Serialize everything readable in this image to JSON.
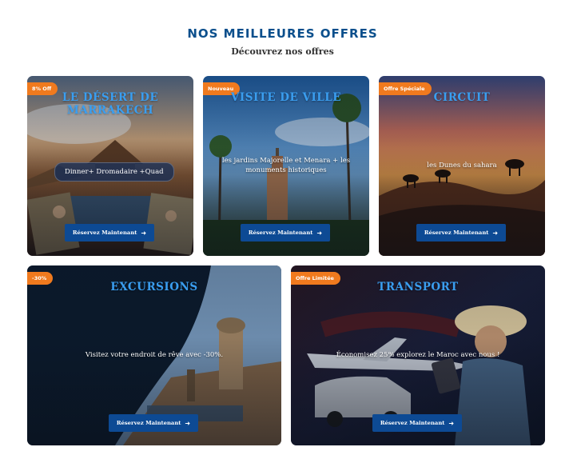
{
  "section": {
    "title": "NOS MEILLEURES OFFRES",
    "subtitle": "Découvrez nos offres"
  },
  "cards": [
    {
      "badge": "8% Off",
      "title": "LE DÉSERT DE MARRAKECH",
      "description": "Dinner+ Dromadaire +Quad",
      "button": "Réservez Maintenant",
      "button_icon": "arrow-right-icon"
    },
    {
      "badge": "Nouveau",
      "title": "VISITE DE VILLE",
      "description": "les jardins Majorelle et Menara + les monuments historiques",
      "button": "Réservez Maintenant",
      "button_icon": "arrow-right-icon"
    },
    {
      "badge": "Offre Spéciale",
      "title": "CIRCUIT",
      "description": "les Dunes du sahara",
      "button": "Réservez Maintenant",
      "button_icon": "arrow-right-icon"
    },
    {
      "badge": "-30%",
      "title": "EXCURSIONS",
      "description": "Visitez votre endroit de rêve avec -30%.",
      "button": "Réservez Maintenant",
      "button_icon": "arrow-right-icon"
    },
    {
      "badge": "Offre Limitée",
      "title": "TRANSPORT",
      "description": "Économisez 25% explorez le Maroc avec nous !",
      "button": "Réservez Maintenant",
      "button_icon": "arrow-right-icon"
    }
  ],
  "colors": {
    "heading": "#0b4f8c",
    "card_title": "#3a9ef0",
    "badge": "#f07a1e",
    "button": "#0d4a94"
  }
}
